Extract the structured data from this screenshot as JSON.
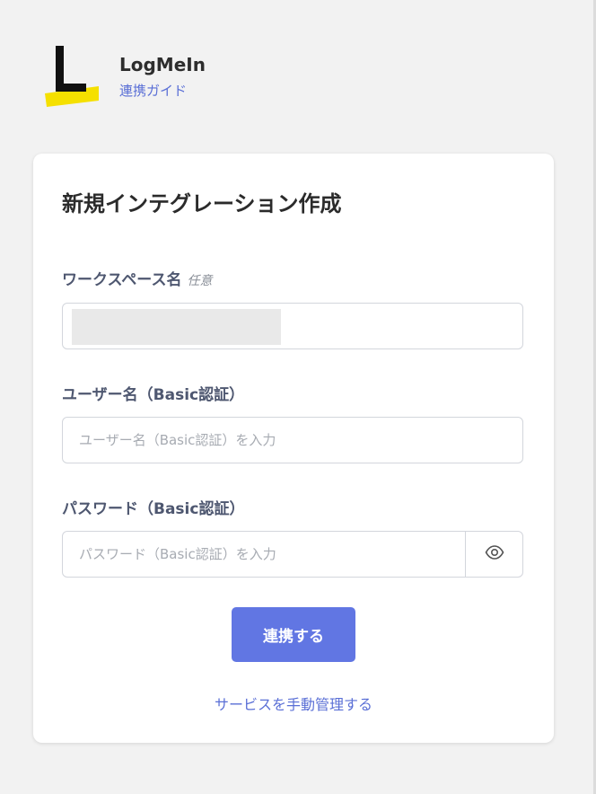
{
  "header": {
    "app_name": "LogMeIn",
    "guide_link": "連携ガイド",
    "logo_letter": "L",
    "logo_accent_color": "#f5e000"
  },
  "form": {
    "title": "新規インテグレーション作成",
    "workspace": {
      "label": "ワークスペース名",
      "optional_tag": "任意"
    },
    "username": {
      "label": "ユーザー名（Basic認証）",
      "placeholder": "ユーザー名（Basic認証）を入力"
    },
    "password": {
      "label": "パスワード（Basic認証）",
      "placeholder": "パスワード（Basic認証）を入力",
      "toggle_icon": "eye-icon"
    },
    "submit_label": "連携する",
    "manual_link": "サービスを手動管理する",
    "accent_color": "#6176e3"
  }
}
